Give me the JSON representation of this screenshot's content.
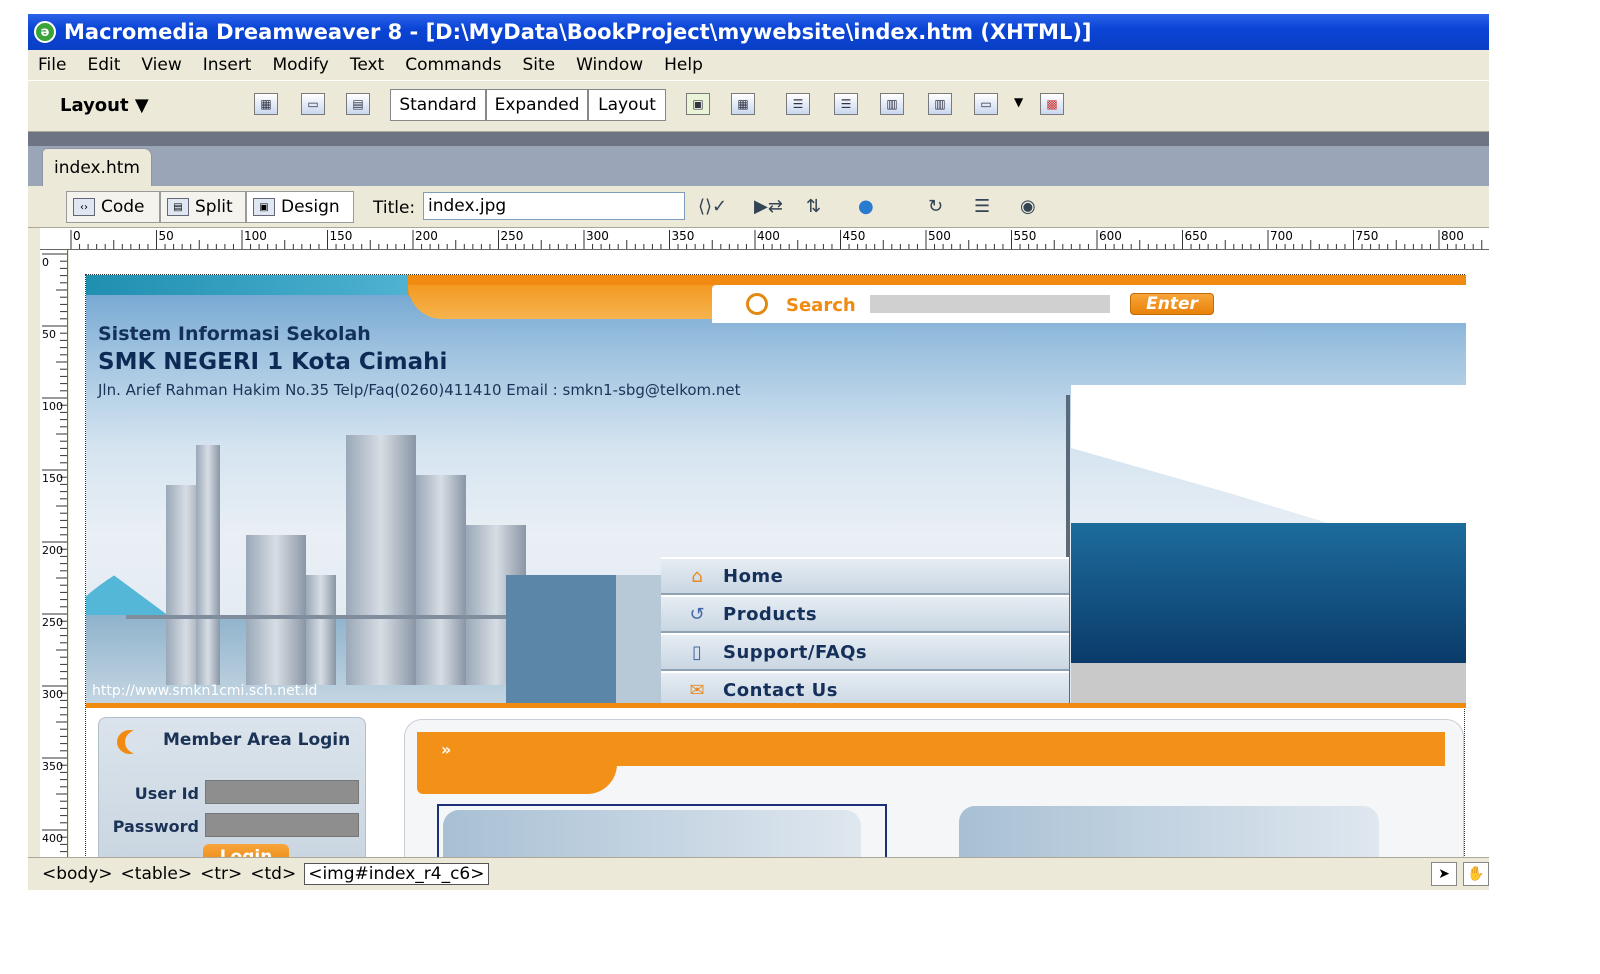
{
  "window": {
    "title": "Macromedia Dreamweaver 8 - [D:\\MyData\\BookProject\\mywebsite\\index.htm (XHTML)]"
  },
  "menu": [
    "File",
    "Edit",
    "View",
    "Insert",
    "Modify",
    "Text",
    "Commands",
    "Site",
    "Window",
    "Help"
  ],
  "insert_toolbar": {
    "category": "Layout",
    "modes": [
      "Standard",
      "Expanded",
      "Layout"
    ]
  },
  "document_tab": "index.htm",
  "doc_toolbar": {
    "views": [
      "Code",
      "Split",
      "Design"
    ],
    "title_label": "Title:",
    "title_value": "index.jpg"
  },
  "ruler": {
    "h_ticks": [
      "0",
      "50",
      "100",
      "150",
      "200",
      "250",
      "300",
      "350",
      "400",
      "450",
      "500",
      "550",
      "600",
      "650",
      "700",
      "750",
      "800"
    ],
    "v_ticks": [
      "0",
      "50",
      "100",
      "150",
      "200",
      "250",
      "300",
      "350",
      "400"
    ]
  },
  "site": {
    "search_label": "Search",
    "enter_label": "Enter",
    "subtitle": "Sistem Informasi Sekolah",
    "name": "SMK NEGERI 1 Kota Cimahi",
    "address": "Jln. Arief Rahman Hakim No.35 Telp/Faq(0260)411410 Email : smkn1-sbg@telkom.net",
    "url": "http://www.smkn1cmi.sch.net.id",
    "nav": [
      "Home",
      "Products",
      "Support/FAQs",
      "Contact Us"
    ],
    "login": {
      "title": "Member Area Login",
      "user_label": "User Id",
      "password_label": "Password",
      "button": "Login"
    },
    "content_arrows": "»"
  },
  "status_bar": {
    "tags": [
      "<body>",
      "<table>",
      "<tr>",
      "<td>"
    ],
    "selected_tag": "<img#index_r4_c6>"
  },
  "colors": {
    "accent_orange": "#f08a10",
    "title_blue": "#0a3fc6"
  }
}
